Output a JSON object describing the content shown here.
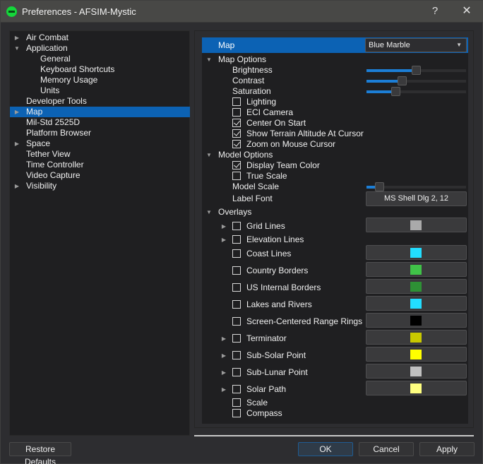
{
  "window": {
    "title": "Preferences - AFSIM-Mystic",
    "help_label": "?",
    "close_label": "✕"
  },
  "tree": {
    "items": [
      {
        "label": "Air Combat",
        "arrow": "▶",
        "level": 0
      },
      {
        "label": "Application",
        "arrow": "▼",
        "level": 0
      },
      {
        "label": "General",
        "arrow": "",
        "level": 1
      },
      {
        "label": "Keyboard Shortcuts",
        "arrow": "",
        "level": 1
      },
      {
        "label": "Memory Usage",
        "arrow": "",
        "level": 1
      },
      {
        "label": "Units",
        "arrow": "",
        "level": 1
      },
      {
        "label": "Developer Tools",
        "arrow": "",
        "level": 0
      },
      {
        "label": "Map",
        "arrow": "▶",
        "level": 0,
        "selected": true
      },
      {
        "label": "Mil-Std 2525D",
        "arrow": "",
        "level": 0
      },
      {
        "label": "Platform Browser",
        "arrow": "",
        "level": 0
      },
      {
        "label": "Space",
        "arrow": "▶",
        "level": 0
      },
      {
        "label": "Tether View",
        "arrow": "",
        "level": 0
      },
      {
        "label": "Time Controller",
        "arrow": "",
        "level": 0
      },
      {
        "label": "Video Capture",
        "arrow": "",
        "level": 0
      },
      {
        "label": "Visibility",
        "arrow": "▶",
        "level": 0
      }
    ]
  },
  "props": {
    "map_label": "Map",
    "map_value": "Blue Marble",
    "map_arrow": "▼",
    "map_options": {
      "label": "Map Options",
      "arrow": "▼",
      "brightness": {
        "label": "Brightness",
        "value": 0.5
      },
      "contrast": {
        "label": "Contrast",
        "value": 0.34
      },
      "saturation": {
        "label": "Saturation",
        "value": 0.27
      },
      "lighting": {
        "label": "Lighting",
        "checked": false
      },
      "eci_camera": {
        "label": "ECI Camera",
        "checked": false
      },
      "center_on_start": {
        "label": "Center On Start",
        "checked": true
      },
      "show_terrain": {
        "label": "Show Terrain Altitude At Cursor",
        "checked": true
      },
      "zoom_on_mouse": {
        "label": "Zoom on Mouse Cursor",
        "checked": true
      }
    },
    "model_options": {
      "label": "Model Options",
      "arrow": "▼",
      "display_team_color": {
        "label": "Display Team Color",
        "checked": true
      },
      "true_scale": {
        "label": "True Scale",
        "checked": false
      },
      "model_scale": {
        "label": "Model Scale",
        "value": 0.09
      },
      "label_font": {
        "label": "Label Font",
        "value": "MS Shell Dlg 2, 12"
      }
    },
    "overlays": {
      "label": "Overlays",
      "arrow": "▼",
      "items": [
        {
          "label": "Grid Lines",
          "expandable": true,
          "checked": false,
          "color": "#aaaaaa"
        },
        {
          "label": "Elevation Lines",
          "expandable": true,
          "checked": false,
          "color": null
        },
        {
          "label": "Coast Lines",
          "expandable": false,
          "checked": false,
          "color": "#22ddff"
        },
        {
          "label": "Country Borders",
          "expandable": false,
          "checked": false,
          "color": "#40c348"
        },
        {
          "label": "US Internal Borders",
          "expandable": false,
          "checked": false,
          "color": "#2e9135"
        },
        {
          "label": "Lakes and Rivers",
          "expandable": false,
          "checked": false,
          "color": "#22ddff"
        },
        {
          "label": "Screen-Centered Range Rings",
          "expandable": false,
          "checked": false,
          "color": "#000000"
        },
        {
          "label": "Terminator",
          "expandable": true,
          "checked": false,
          "color": "#c8c800"
        },
        {
          "label": "Sub-Solar Point",
          "expandable": true,
          "checked": false,
          "color": "#ffff00"
        },
        {
          "label": "Sub-Lunar Point",
          "expandable": true,
          "checked": false,
          "color": "#c0c0c0"
        },
        {
          "label": "Solar Path",
          "expandable": true,
          "checked": false,
          "color": "#ffff80"
        },
        {
          "label": "Scale",
          "expandable": false,
          "checked": false,
          "color": null
        },
        {
          "label": "Compass",
          "expandable": false,
          "checked": false,
          "color": null
        }
      ]
    }
  },
  "buttons": {
    "restore_defaults": "Restore Defaults",
    "ok": "OK",
    "cancel": "Cancel",
    "apply": "Apply"
  },
  "colors": {
    "accent": "#0c62b4",
    "slider_fill": "#1c7ed6",
    "app_icon": "#14d63a"
  }
}
